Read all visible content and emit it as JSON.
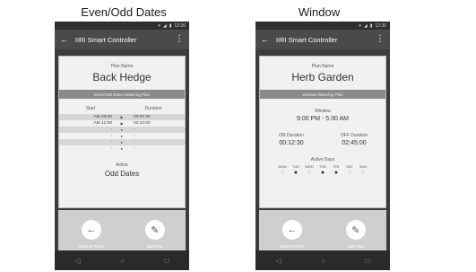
{
  "captions": {
    "left": "Even/Odd Dates",
    "right": "Window"
  },
  "status": {
    "time": "12:30"
  },
  "app_title": "IIRI Smart Controller",
  "left_phone": {
    "plan_name_label": "Plan Name",
    "plan_name": "Back Hedge",
    "plan_type": "Even/Odd Dates Watering Plan",
    "start_header": "Start",
    "duration_header": "Duration",
    "rows": [
      {
        "start": "AM 03:00",
        "arrow": "▶",
        "duration": "00:00:30"
      },
      {
        "start": "AM 12:00",
        "arrow": "▶",
        "duration": "00:10:00"
      },
      {
        "start": "-",
        "arrow": "▸",
        "duration": "-"
      },
      {
        "start": "-",
        "arrow": "▸",
        "duration": "-"
      },
      {
        "start": "-",
        "arrow": "▸",
        "duration": "-"
      },
      {
        "start": "-",
        "arrow": "▸",
        "duration": "-"
      }
    ],
    "active_label": "Active",
    "active_value": "Odd Dates",
    "back_label": "Back to Plans",
    "edit_label": "Edit Plan"
  },
  "right_phone": {
    "plan_name_label": "Plan Name",
    "plan_name": "Herb Garden",
    "plan_type": "Window Watering Plan",
    "window_label": "Window",
    "window_value": "9:00 PM - 5:30 AM",
    "on_duration_label": "ON Duration",
    "on_duration_value": "00:12:30",
    "off_duration_label": "OFF Duration",
    "off_duration_value": "02:45:00",
    "active_days_label": "Active Days",
    "days": [
      {
        "name": "MON",
        "active": false
      },
      {
        "name": "TUE",
        "active": true
      },
      {
        "name": "WED",
        "active": false
      },
      {
        "name": "THU",
        "active": true
      },
      {
        "name": "FRI",
        "active": true
      },
      {
        "name": "SAT",
        "active": false
      },
      {
        "name": "SUN",
        "active": false
      }
    ],
    "back_label": "Back to Plans",
    "edit_label": "Edit Plan"
  },
  "icons": {
    "back": "←",
    "menu": "⋮",
    "edit": "✎",
    "nav_back": "◁",
    "nav_home": "○",
    "nav_recent": "□",
    "drop_on": "●",
    "drop_off": "○"
  },
  "colors": {
    "appbar": "#4a4a4a",
    "plan_type_bar": "#8a8a8a",
    "card": "#f1f1f1"
  }
}
